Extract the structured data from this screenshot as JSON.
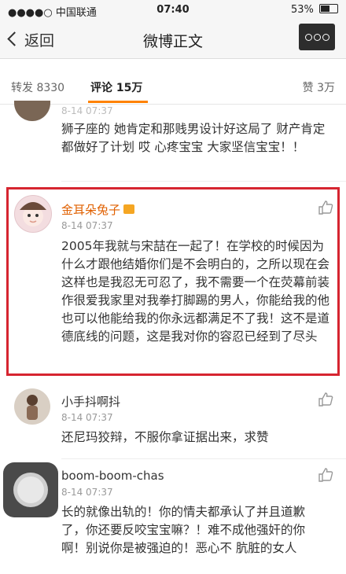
{
  "status_bar": {
    "carrier": "●●●●○ 中国联通",
    "time": "07:40",
    "battery": "53%"
  },
  "nav": {
    "back_label": "返回",
    "title": "微博正文"
  },
  "tabs": {
    "repost": "转发 8330",
    "comments": "评论 15万",
    "likes": "赞 3万"
  },
  "comments": [
    {
      "time": "8-14 07:37",
      "text": "狮子座的 她肯定和那贱男设计好这局了 财产肯定都做好了计划 哎 心疼宝宝 大家坚信宝宝！！"
    },
    {
      "name": "金耳朵兔子",
      "time": "8-14 07:37",
      "text": "2005年我就与宋喆在一起了！在学校的时候因为什么才跟他结婚你们是不会明白的，之所以现在会这样也是我忍无可忍了，我不需要一个在荧幕前装作很爱我家里对我拳打脚踢的男人，你能给我的他也可以他能给我的你永远都满足不了我！这不是道德底线的问题，这是我对你的容忍已经到了尽头"
    },
    {
      "name": "小手抖啊抖",
      "time": "8-14 07:37",
      "text": "还尼玛狡辩，不服你拿证据出来，求赞"
    },
    {
      "name": "boom-boom-chas",
      "time": "8-14 07:37",
      "text": "长的就像出轨的！你的情夫都承认了并且道歉了，你还要反咬宝宝嘛？！难不成他强奸的你啊！别说你是被强迫的！恶心不 肮脏的女人"
    }
  ],
  "colors": {
    "accent": "#ff8200",
    "name_highlight": "#e06000",
    "highlight_border": "#d62530"
  }
}
